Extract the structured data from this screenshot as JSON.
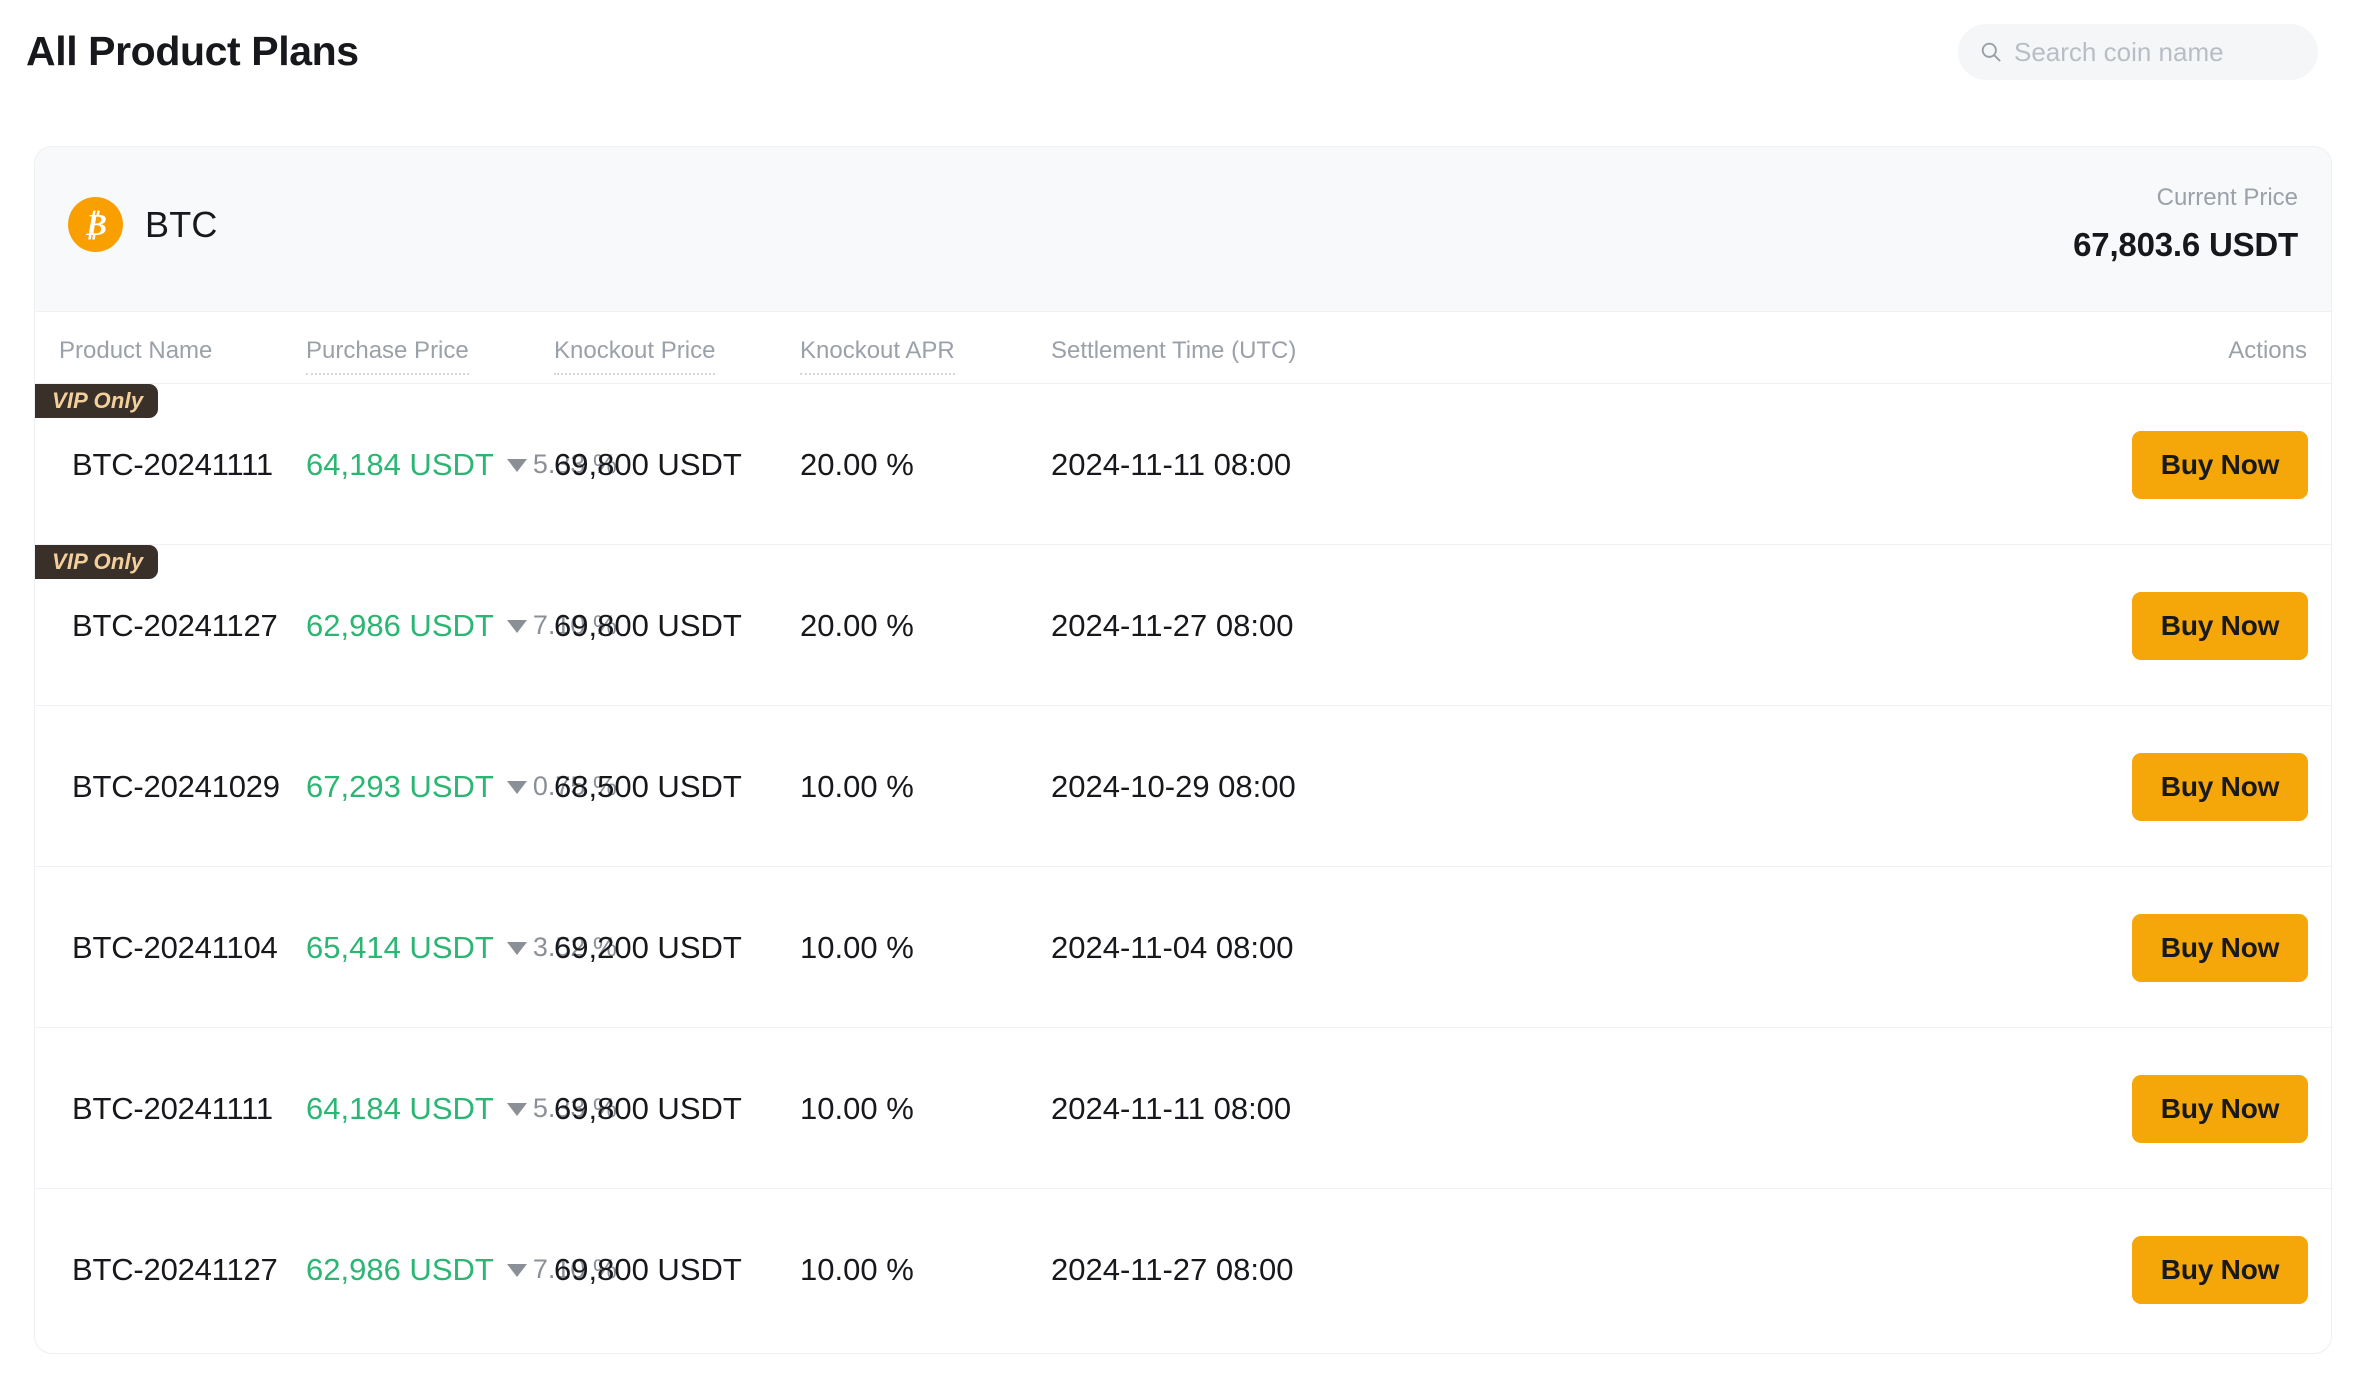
{
  "header": {
    "title": "All Product Plans",
    "search": {
      "placeholder": "Search coin name",
      "value": "",
      "icon": "search-icon"
    }
  },
  "coin": {
    "symbol": "BTC",
    "icon": "bitcoin-icon",
    "icon_color": "#f9a000",
    "current_price_label": "Current Price",
    "current_price_value": "67,803.6 USDT"
  },
  "table": {
    "columns": [
      {
        "key": "name",
        "label": "Product Name",
        "tooltip": false,
        "align": "left"
      },
      {
        "key": "buy",
        "label": "Purchase Price",
        "tooltip": true,
        "align": "left"
      },
      {
        "key": "knock",
        "label": "Knockout Price",
        "tooltip": true,
        "align": "left"
      },
      {
        "key": "apr",
        "label": "Knockout APR",
        "tooltip": true,
        "align": "left"
      },
      {
        "key": "time",
        "label": "Settlement Time (UTC)",
        "tooltip": false,
        "align": "left"
      },
      {
        "key": "act",
        "label": "Actions",
        "tooltip": false,
        "align": "right"
      }
    ],
    "vip_badge_label": "VIP Only",
    "buy_button_label": "Buy Now",
    "rows": [
      {
        "vip": true,
        "name": "BTC-20241111",
        "purchase_price": "64,184 USDT",
        "delta_direction": "down",
        "delta_percent": "5.33 %",
        "knockout_price": "69,800 USDT",
        "knockout_apr": "20.00 %",
        "settlement_time": "2024-11-11 08:00",
        "action_label": "Buy Now"
      },
      {
        "vip": true,
        "name": "BTC-20241127",
        "purchase_price": "62,986 USDT",
        "delta_direction": "down",
        "delta_percent": "7.10 %",
        "knockout_price": "69,800 USDT",
        "knockout_apr": "20.00 %",
        "settlement_time": "2024-11-27 08:00",
        "action_label": "Buy Now"
      },
      {
        "vip": false,
        "name": "BTC-20241029",
        "purchase_price": "67,293 USDT",
        "delta_direction": "down",
        "delta_percent": "0.75 %",
        "knockout_price": "68,500 USDT",
        "knockout_apr": "10.00 %",
        "settlement_time": "2024-10-29 08:00",
        "action_label": "Buy Now"
      },
      {
        "vip": false,
        "name": "BTC-20241104",
        "purchase_price": "65,414 USDT",
        "delta_direction": "down",
        "delta_percent": "3.52 %",
        "knockout_price": "69,200 USDT",
        "knockout_apr": "10.00 %",
        "settlement_time": "2024-11-04 08:00",
        "action_label": "Buy Now"
      },
      {
        "vip": false,
        "name": "BTC-20241111",
        "purchase_price": "64,184 USDT",
        "delta_direction": "down",
        "delta_percent": "5.33 %",
        "knockout_price": "69,800 USDT",
        "knockout_apr": "10.00 %",
        "settlement_time": "2024-11-11 08:00",
        "action_label": "Buy Now"
      },
      {
        "vip": false,
        "name": "BTC-20241127",
        "purchase_price": "62,986 USDT",
        "delta_direction": "down",
        "delta_percent": "7.10 %",
        "knockout_price": "69,800 USDT",
        "knockout_apr": "10.00 %",
        "settlement_time": "2024-11-27 08:00",
        "action_label": "Buy Now"
      }
    ]
  },
  "colors": {
    "accent": "#f5a609",
    "positive_price": "#2bb673",
    "vip_badge_bg": "#39302a",
    "vip_badge_text": "#f3cf9c",
    "muted_text": "#9ba1a9"
  }
}
